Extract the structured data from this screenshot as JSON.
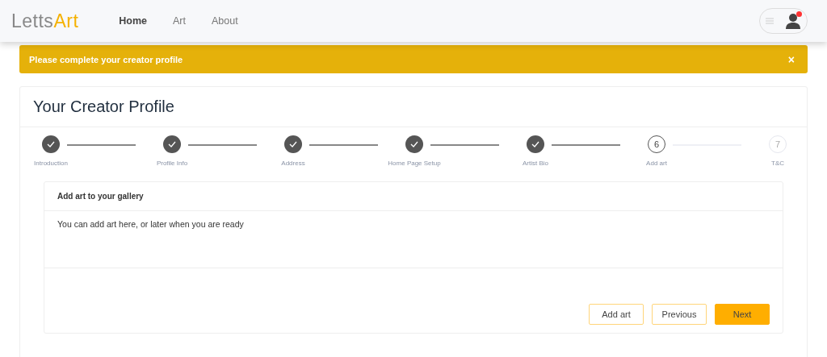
{
  "navbar": {
    "logo": {
      "part_1": "Letts",
      "part_2": "Art"
    },
    "links": [
      {
        "label": "Home",
        "selected": true
      },
      {
        "label": "Art",
        "selected": false
      },
      {
        "label": "About",
        "selected": false
      }
    ],
    "account": {
      "notification": true
    }
  },
  "alert": {
    "message": "Please complete your creator profile",
    "close": "×"
  },
  "page": {
    "title": "Your Creator Profile",
    "steps": [
      {
        "label": "Introduction",
        "completed": true,
        "selected": false
      },
      {
        "label": "Profile Info",
        "completed": true,
        "selected": false
      },
      {
        "label": "Address",
        "completed": true,
        "selected": false
      },
      {
        "label": "Home Page Setup",
        "completed": true,
        "selected": false
      },
      {
        "label": "Artist Bio",
        "completed": true,
        "selected": false
      },
      {
        "label": "Add art",
        "completed": false,
        "selected": true,
        "number": "6"
      },
      {
        "label": "T&C",
        "completed": false,
        "selected": false,
        "number": "7"
      }
    ],
    "panel": {
      "title": "Add art to your gallery",
      "text": "You can add art here, or later when you are ready",
      "buttons": [
        {
          "label": "Add art",
          "kind": "outline"
        },
        {
          "label": "Previous",
          "kind": "outline"
        },
        {
          "label": "Next",
          "kind": "primary"
        }
      ]
    }
  }
}
